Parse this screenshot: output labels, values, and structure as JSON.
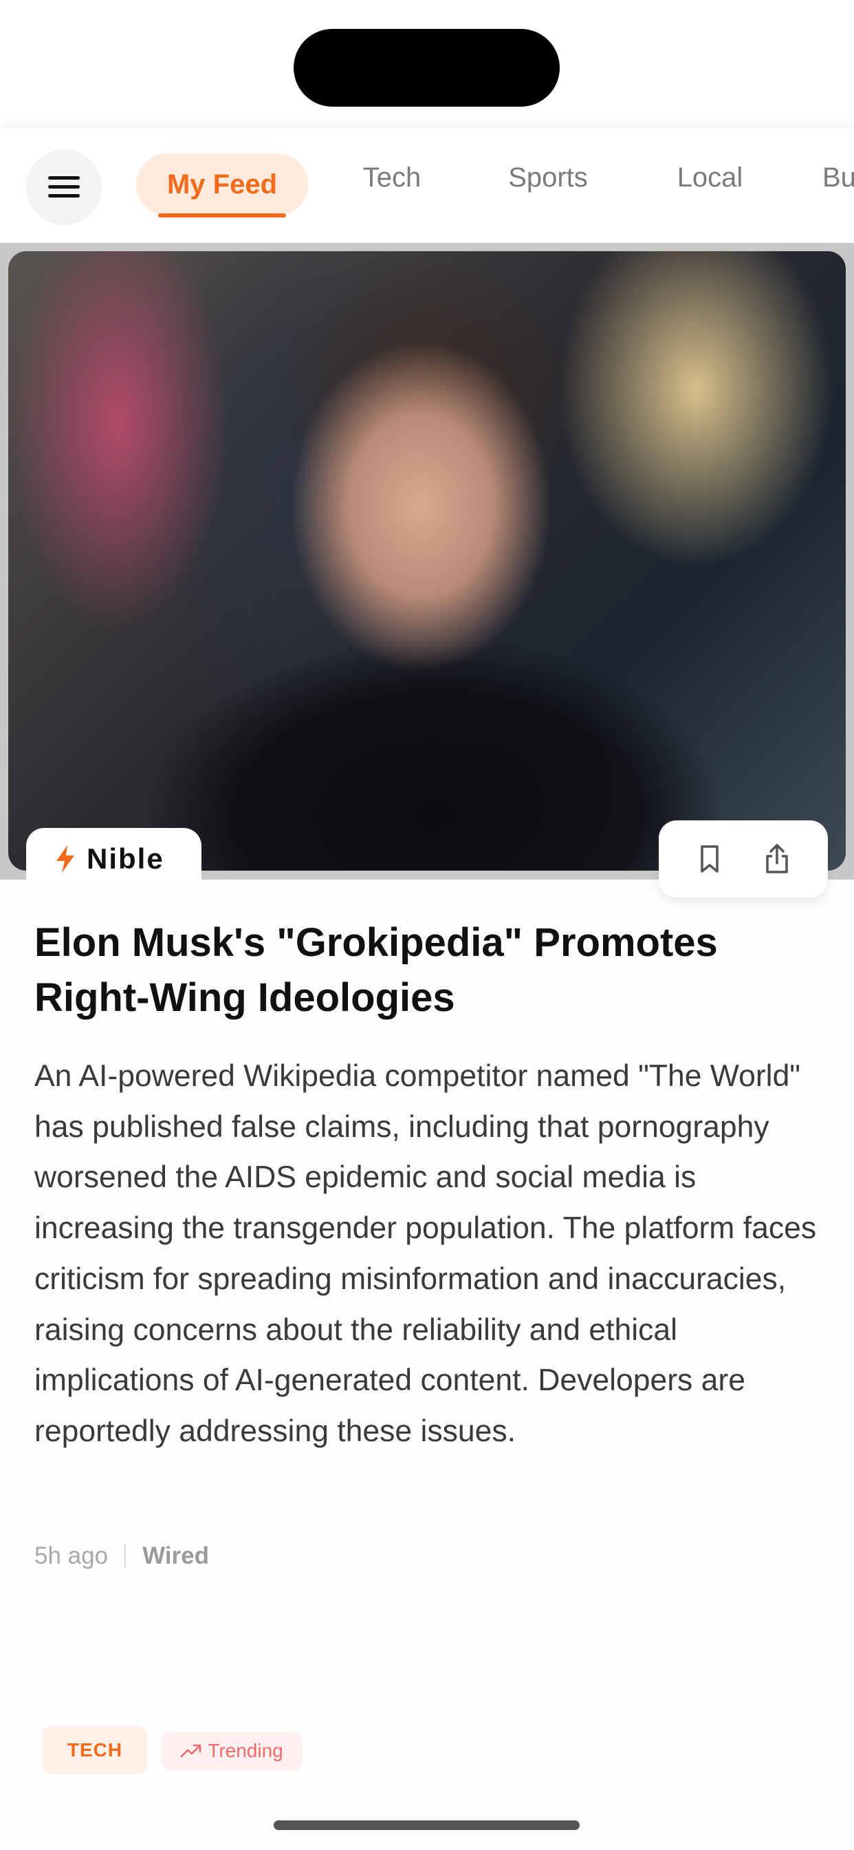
{
  "tabs": {
    "items": [
      {
        "label": "My Feed",
        "active": true
      },
      {
        "label": "Tech"
      },
      {
        "label": "Sports"
      },
      {
        "label": "Local"
      },
      {
        "label": "Bu"
      }
    ],
    "accent_color": "#f26a1b"
  },
  "article": {
    "source_badge": "Nible",
    "headline": "Elon Musk's \"Grokipedia\" Promotes Right-Wing Ideologies",
    "summary": "An AI-powered Wikipedia competitor named \"The World\" has published false claims, including that pornography worsened the AIDS epidemic and social media is increasing the transgender population. The platform faces criticism for spreading misinformation and inaccuracies, raising concerns about the reliability and ethical implications of AI-generated content. Developers are reportedly addressing these issues.",
    "time": "5h ago",
    "source": "Wired"
  },
  "tags": {
    "category": "TECH",
    "trending": "Trending"
  },
  "icons": [
    "menu-icon",
    "bolt-icon",
    "bookmark-icon",
    "share-icon",
    "trending-arrow-icon"
  ]
}
